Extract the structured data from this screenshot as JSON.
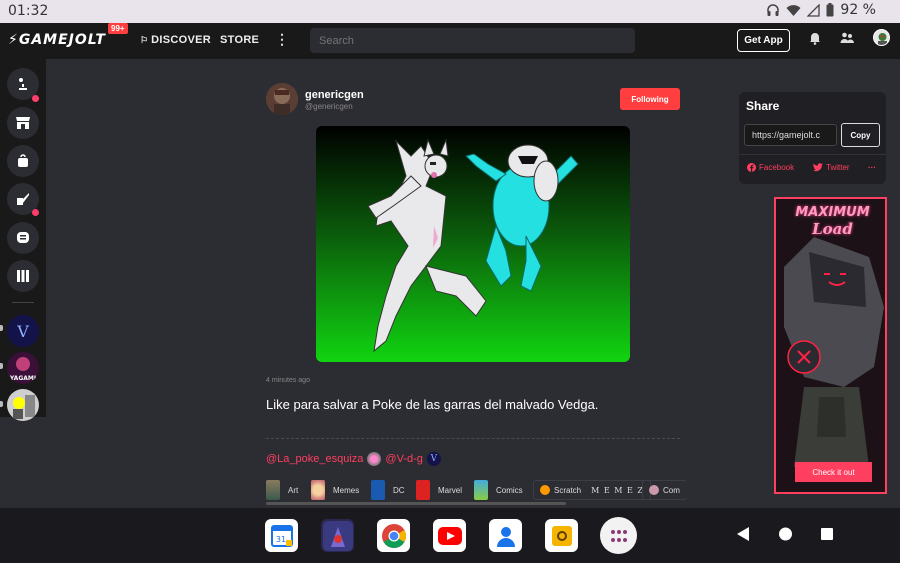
{
  "status_bar": {
    "time": "01:32",
    "battery": "92 %"
  },
  "topnav": {
    "logo": "GAMEJOLT",
    "notification_count": "99+",
    "discover": "DISCOVER",
    "store": "STORE",
    "search_placeholder": "Search",
    "get_app": "Get App"
  },
  "post": {
    "author_name": "genericgen",
    "author_handle": "@genericgen",
    "follow_label": "Following",
    "time_ago": "4 minutes ago",
    "text": "Like para salvar a Poke de las garras del malvado Vedga.",
    "mentions": [
      "@La_poke_esquiza",
      "@V-d-g"
    ],
    "tags": [
      {
        "label": "Art"
      },
      {
        "label": "Memes"
      },
      {
        "label": "DC"
      },
      {
        "label": "Marvel"
      },
      {
        "label": "Comics"
      },
      {
        "label": "Scratch"
      },
      {
        "label": "M E M E Z"
      },
      {
        "label": "Com"
      }
    ]
  },
  "share": {
    "title": "Share",
    "url": "https://gamejolt.c",
    "copy_label": "Copy",
    "facebook": "Facebook",
    "twitter": "Twitter",
    "more": "···"
  },
  "ad": {
    "title_line1": "MAXIMUM",
    "title_line2": "Load",
    "cta": "Check it out"
  },
  "dock": {
    "calendar_date": "31",
    "apps": [
      "calendar-icon",
      "game-icon",
      "chrome-icon",
      "youtube-icon",
      "contacts-icon",
      "files-icon",
      "app-drawer-icon"
    ]
  },
  "colors": {
    "accent": "#ff3f5f",
    "follow": "#ff3f3f",
    "nav_bg": "#191919",
    "page_bg": "#2c2c33"
  }
}
